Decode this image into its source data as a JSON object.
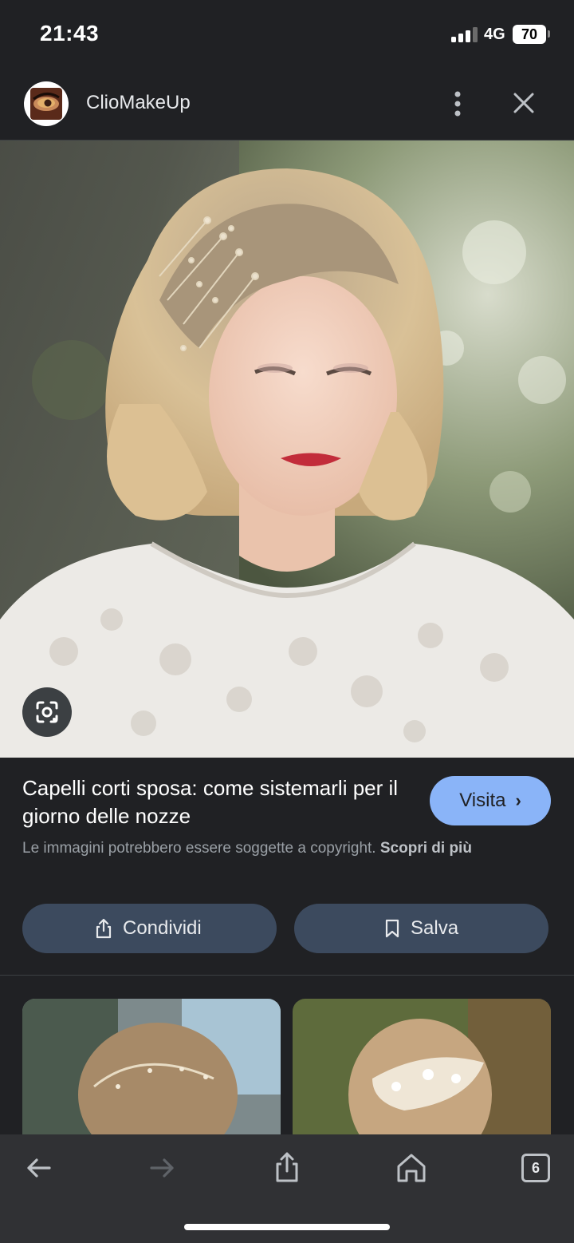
{
  "status": {
    "time": "21:43",
    "network": "4G",
    "battery": "70"
  },
  "header": {
    "site_name": "ClioMakeUp",
    "more_icon": "more-vert-icon",
    "close_icon": "close-icon"
  },
  "result": {
    "title": "Capelli corti sposa: come sistemarli per il giorno delle nozze",
    "visit_label": "Visita",
    "copyright_text": "Le immagini potrebbero essere soggette a copyright.",
    "learn_more": "Scopri di più"
  },
  "actions": {
    "share_label": "Condividi",
    "save_label": "Salva"
  },
  "bottom_nav": {
    "tab_count": "6"
  },
  "colors": {
    "background": "#202124",
    "accent": "#8ab4f8",
    "pill": "#3c4a5e"
  }
}
